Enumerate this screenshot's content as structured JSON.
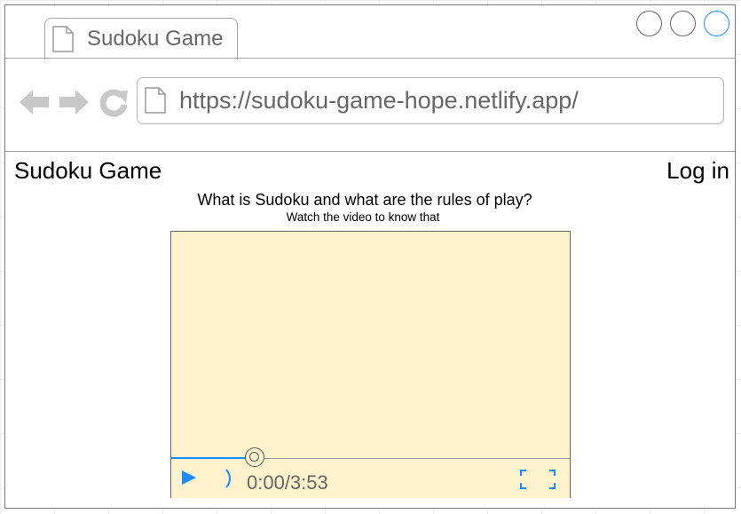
{
  "browser": {
    "tab_title": "Sudoku Game",
    "url": "https://sudoku-game-hope.netlify.app/",
    "accent_color": "#1a8cff"
  },
  "page": {
    "site_title": "Sudoku Game",
    "login_label": "Log in",
    "heading": "What is Sudoku and what are the rules of play?",
    "subheading": "Watch the video to know that"
  },
  "video": {
    "time_display": "0:00/3:53",
    "progress_fraction": 0.21,
    "background_color": "#fff2cc",
    "icons": [
      "play-icon",
      "volume-icon",
      "fullscreen-icon"
    ]
  }
}
